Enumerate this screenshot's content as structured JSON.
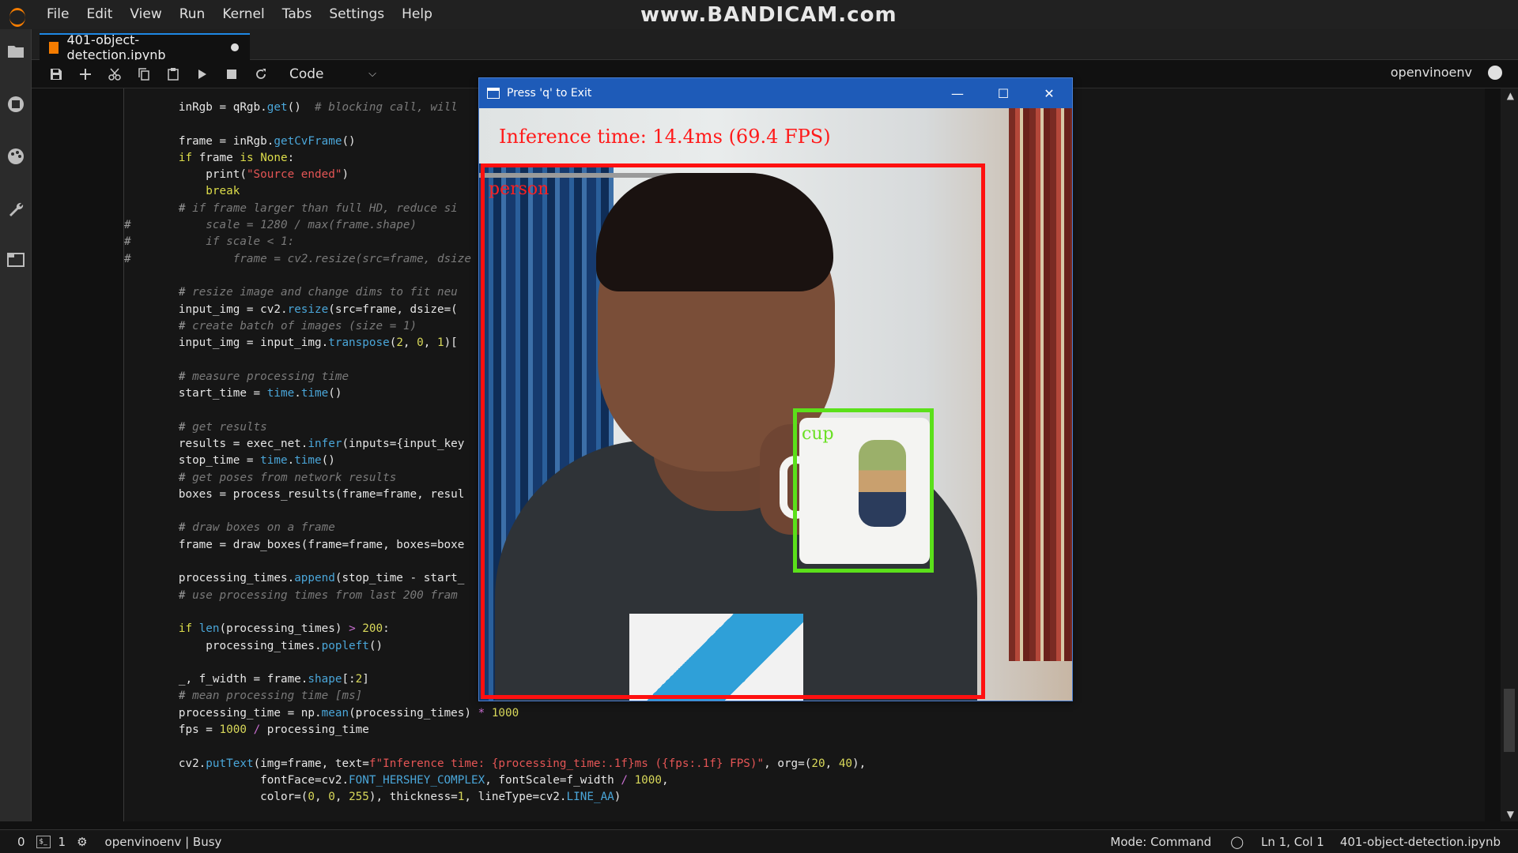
{
  "menubar": {
    "items": [
      "File",
      "Edit",
      "View",
      "Run",
      "Kernel",
      "Tabs",
      "Settings",
      "Help"
    ],
    "watermark": "www.BANDICAM.com"
  },
  "sidebar": {
    "icons": [
      "folder-icon",
      "running-icon",
      "palette-icon",
      "wrench-icon",
      "tabs-icon"
    ]
  },
  "tab": {
    "label": "401-object-detection.ipynb"
  },
  "toolbar": {
    "cell_type": "Code",
    "kernel_name": "openvinoenv"
  },
  "code": {
    "lines": [
      "        inRgb = qRgb.get()  # blocking call, will",
      "",
      "        frame = inRgb.getCvFrame()",
      "        if frame is None:",
      "            print(\"Source ended\")",
      "            break",
      "        # if frame larger than full HD, reduce si",
      "#           scale = 1280 / max(frame.shape)",
      "#           if scale < 1:",
      "#               frame = cv2.resize(src=frame, dsize",
      "",
      "        # resize image and change dims to fit neu",
      "        input_img = cv2.resize(src=frame, dsize=(",
      "        # create batch of images (size = 1)",
      "        input_img = input_img.transpose(2, 0, 1)[",
      "",
      "        # measure processing time",
      "        start_time = time.time()",
      "",
      "        # get results",
      "        results = exec_net.infer(inputs={input_key",
      "        stop_time = time.time()",
      "        # get poses from network results",
      "        boxes = process_results(frame=frame, resul",
      "",
      "        # draw boxes on a frame",
      "        frame = draw_boxes(frame=frame, boxes=boxe",
      "",
      "        processing_times.append(stop_time - start_",
      "        # use processing times from last 200 fram",
      "",
      "        if len(processing_times) > 200:",
      "            processing_times.popleft()",
      "",
      "        _, f_width = frame.shape[:2]",
      "        # mean processing time [ms]",
      "        processing_time = np.mean(processing_times) * 1000",
      "        fps = 1000 / processing_time",
      "",
      "        cv2.putText(img=frame, text=f\"Inference time: {processing_time:.1f}ms ({fps:.1f} FPS)\", org=(20, 40),",
      "                    fontFace=cv2.FONT_HERSHEY_COMPLEX, fontScale=f_width / 1000,",
      "                    color=(0, 0, 255), thickness=1, lineType=cv2.LINE_AA)"
    ]
  },
  "video_window": {
    "title": "Press 'q' to Exit",
    "overlay_text": "Inference time: 14.4ms (69.4 FPS)",
    "detections": [
      {
        "label": "person",
        "color": "#ff1010"
      },
      {
        "label": "cup",
        "color": "#5be01a"
      }
    ]
  },
  "statusbar": {
    "left_count": "0",
    "terminal_count": "1",
    "kernel_status": "openvinoenv | Busy",
    "mode": "Mode: Command",
    "position": "Ln 1, Col 1",
    "filename": "401-object-detection.ipynb"
  }
}
